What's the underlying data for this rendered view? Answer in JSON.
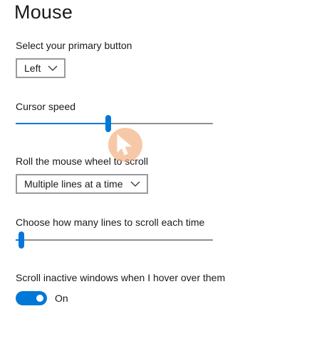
{
  "page": {
    "title": "Mouse"
  },
  "primary_button": {
    "label": "Select your primary button",
    "value": "Left",
    "chevron_icon": "chevron-down-icon"
  },
  "cursor_speed": {
    "label": "Cursor speed",
    "value_fraction": 0.47
  },
  "wheel_scroll": {
    "label": "Roll the mouse wheel to scroll",
    "value": "Multiple lines at a time",
    "chevron_icon": "chevron-down-icon"
  },
  "lines_to_scroll": {
    "label": "Choose how many lines to scroll each time",
    "value_fraction": 0.03
  },
  "inactive_scroll": {
    "label": "Scroll inactive windows when I hover over them",
    "state_text": "On",
    "enabled": true
  },
  "colors": {
    "accent": "#0078d7",
    "track": "#8f8f8f",
    "cursor_highlight": "#f2aa78"
  },
  "overlay": {
    "icon": "cursor-click-icon"
  }
}
